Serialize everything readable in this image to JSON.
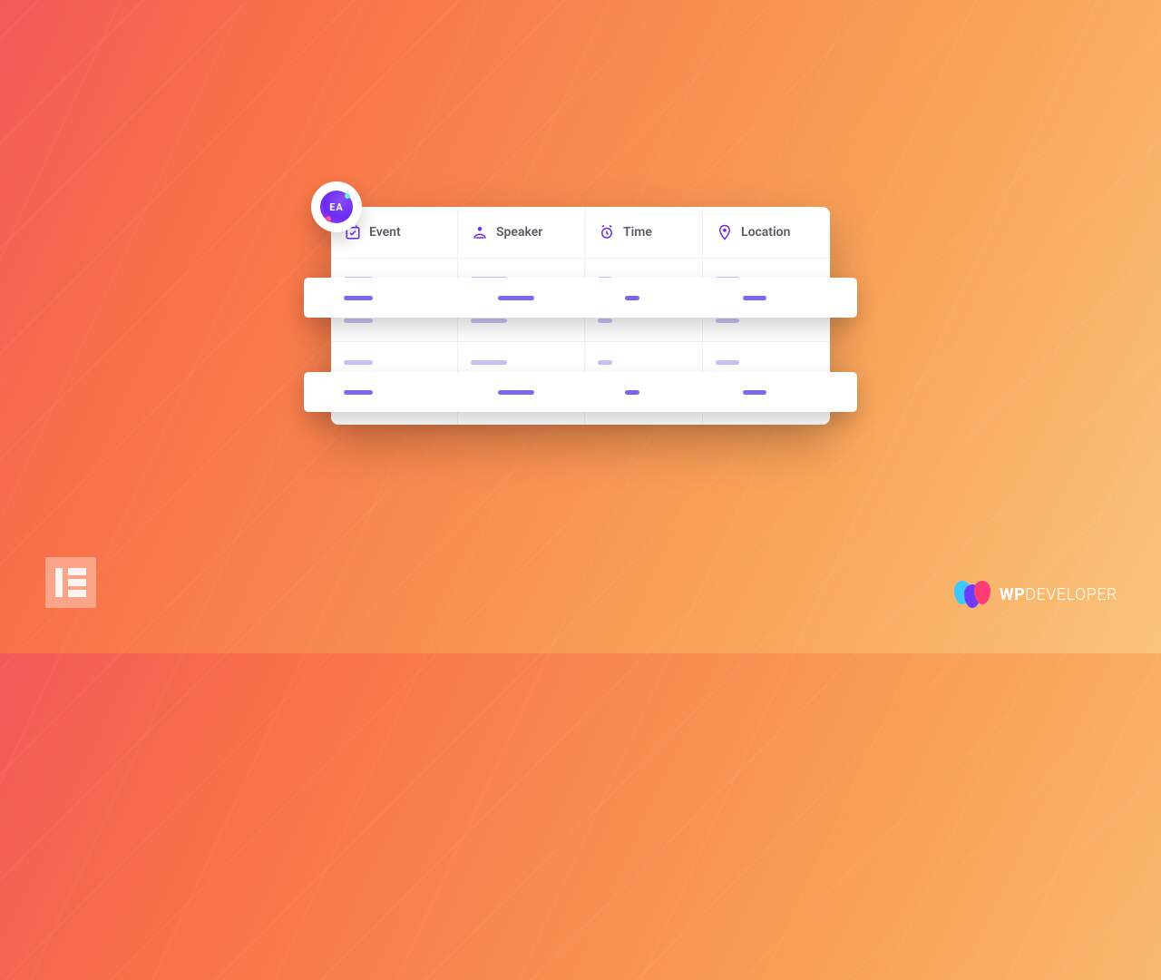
{
  "badge": {
    "label": "EA"
  },
  "table": {
    "headers": [
      {
        "icon": "calendar-check-icon",
        "label": "Event"
      },
      {
        "icon": "user-icon",
        "label": "Speaker"
      },
      {
        "icon": "clock-icon",
        "label": "Time"
      },
      {
        "icon": "location-pin-icon",
        "label": "Location"
      }
    ]
  },
  "brand": {
    "elementor": "Elementor",
    "wp_prefix": "WP",
    "wp_suffix": "DEVELOPER"
  },
  "colors": {
    "accent": "#6a2cf0",
    "placeholder_highlight": "#7e66f2",
    "placeholder_muted": "#c8c0f5"
  }
}
